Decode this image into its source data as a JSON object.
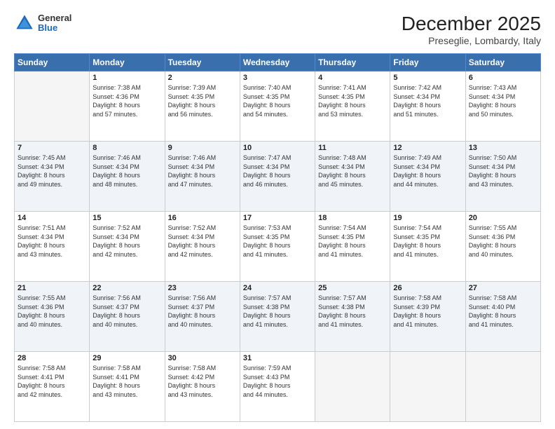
{
  "header": {
    "logo_general": "General",
    "logo_blue": "Blue",
    "title": "December 2025",
    "subtitle": "Preseglie, Lombardy, Italy"
  },
  "weekdays": [
    "Sunday",
    "Monday",
    "Tuesday",
    "Wednesday",
    "Thursday",
    "Friday",
    "Saturday"
  ],
  "weeks": [
    [
      {
        "day": "",
        "info": ""
      },
      {
        "day": "1",
        "info": "Sunrise: 7:38 AM\nSunset: 4:36 PM\nDaylight: 8 hours\nand 57 minutes."
      },
      {
        "day": "2",
        "info": "Sunrise: 7:39 AM\nSunset: 4:35 PM\nDaylight: 8 hours\nand 56 minutes."
      },
      {
        "day": "3",
        "info": "Sunrise: 7:40 AM\nSunset: 4:35 PM\nDaylight: 8 hours\nand 54 minutes."
      },
      {
        "day": "4",
        "info": "Sunrise: 7:41 AM\nSunset: 4:35 PM\nDaylight: 8 hours\nand 53 minutes."
      },
      {
        "day": "5",
        "info": "Sunrise: 7:42 AM\nSunset: 4:34 PM\nDaylight: 8 hours\nand 51 minutes."
      },
      {
        "day": "6",
        "info": "Sunrise: 7:43 AM\nSunset: 4:34 PM\nDaylight: 8 hours\nand 50 minutes."
      }
    ],
    [
      {
        "day": "7",
        "info": "Sunrise: 7:45 AM\nSunset: 4:34 PM\nDaylight: 8 hours\nand 49 minutes."
      },
      {
        "day": "8",
        "info": "Sunrise: 7:46 AM\nSunset: 4:34 PM\nDaylight: 8 hours\nand 48 minutes."
      },
      {
        "day": "9",
        "info": "Sunrise: 7:46 AM\nSunset: 4:34 PM\nDaylight: 8 hours\nand 47 minutes."
      },
      {
        "day": "10",
        "info": "Sunrise: 7:47 AM\nSunset: 4:34 PM\nDaylight: 8 hours\nand 46 minutes."
      },
      {
        "day": "11",
        "info": "Sunrise: 7:48 AM\nSunset: 4:34 PM\nDaylight: 8 hours\nand 45 minutes."
      },
      {
        "day": "12",
        "info": "Sunrise: 7:49 AM\nSunset: 4:34 PM\nDaylight: 8 hours\nand 44 minutes."
      },
      {
        "day": "13",
        "info": "Sunrise: 7:50 AM\nSunset: 4:34 PM\nDaylight: 8 hours\nand 43 minutes."
      }
    ],
    [
      {
        "day": "14",
        "info": "Sunrise: 7:51 AM\nSunset: 4:34 PM\nDaylight: 8 hours\nand 43 minutes."
      },
      {
        "day": "15",
        "info": "Sunrise: 7:52 AM\nSunset: 4:34 PM\nDaylight: 8 hours\nand 42 minutes."
      },
      {
        "day": "16",
        "info": "Sunrise: 7:52 AM\nSunset: 4:34 PM\nDaylight: 8 hours\nand 42 minutes."
      },
      {
        "day": "17",
        "info": "Sunrise: 7:53 AM\nSunset: 4:35 PM\nDaylight: 8 hours\nand 41 minutes."
      },
      {
        "day": "18",
        "info": "Sunrise: 7:54 AM\nSunset: 4:35 PM\nDaylight: 8 hours\nand 41 minutes."
      },
      {
        "day": "19",
        "info": "Sunrise: 7:54 AM\nSunset: 4:35 PM\nDaylight: 8 hours\nand 41 minutes."
      },
      {
        "day": "20",
        "info": "Sunrise: 7:55 AM\nSunset: 4:36 PM\nDaylight: 8 hours\nand 40 minutes."
      }
    ],
    [
      {
        "day": "21",
        "info": "Sunrise: 7:55 AM\nSunset: 4:36 PM\nDaylight: 8 hours\nand 40 minutes."
      },
      {
        "day": "22",
        "info": "Sunrise: 7:56 AM\nSunset: 4:37 PM\nDaylight: 8 hours\nand 40 minutes."
      },
      {
        "day": "23",
        "info": "Sunrise: 7:56 AM\nSunset: 4:37 PM\nDaylight: 8 hours\nand 40 minutes."
      },
      {
        "day": "24",
        "info": "Sunrise: 7:57 AM\nSunset: 4:38 PM\nDaylight: 8 hours\nand 41 minutes."
      },
      {
        "day": "25",
        "info": "Sunrise: 7:57 AM\nSunset: 4:38 PM\nDaylight: 8 hours\nand 41 minutes."
      },
      {
        "day": "26",
        "info": "Sunrise: 7:58 AM\nSunset: 4:39 PM\nDaylight: 8 hours\nand 41 minutes."
      },
      {
        "day": "27",
        "info": "Sunrise: 7:58 AM\nSunset: 4:40 PM\nDaylight: 8 hours\nand 41 minutes."
      }
    ],
    [
      {
        "day": "28",
        "info": "Sunrise: 7:58 AM\nSunset: 4:41 PM\nDaylight: 8 hours\nand 42 minutes."
      },
      {
        "day": "29",
        "info": "Sunrise: 7:58 AM\nSunset: 4:41 PM\nDaylight: 8 hours\nand 43 minutes."
      },
      {
        "day": "30",
        "info": "Sunrise: 7:58 AM\nSunset: 4:42 PM\nDaylight: 8 hours\nand 43 minutes."
      },
      {
        "day": "31",
        "info": "Sunrise: 7:59 AM\nSunset: 4:43 PM\nDaylight: 8 hours\nand 44 minutes."
      },
      {
        "day": "",
        "info": ""
      },
      {
        "day": "",
        "info": ""
      },
      {
        "day": "",
        "info": ""
      }
    ]
  ]
}
